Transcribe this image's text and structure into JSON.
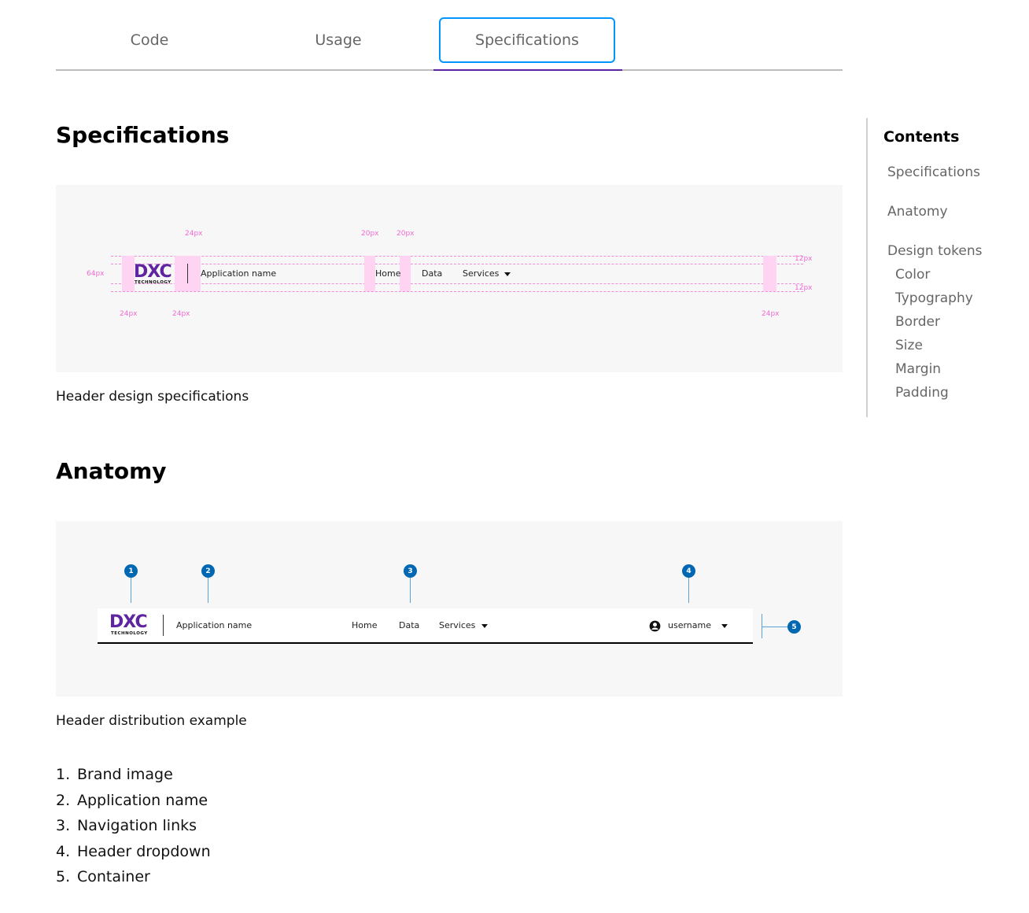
{
  "tabs": [
    {
      "label": "Code"
    },
    {
      "label": "Usage"
    },
    {
      "label": "Specifications"
    }
  ],
  "sections": {
    "specifications": {
      "title": "Specifications",
      "caption": "Header design specifications",
      "diagram": {
        "app_name": "Application name",
        "nav": [
          "Home",
          "Data",
          "Services"
        ],
        "logo_text": "DXC",
        "logo_sub": "TECHNOLOGY",
        "measure_24": "24px",
        "measure_20": "20px",
        "measure_64": "64px",
        "measure_12": "12px"
      }
    },
    "anatomy": {
      "title": "Anatomy",
      "caption": "Header distribution example",
      "diagram": {
        "app_name": "Application name",
        "nav": [
          "Home",
          "Data",
          "Services"
        ],
        "username": "username",
        "logo_text": "DXC",
        "logo_sub": "TECHNOLOGY",
        "badges": [
          "1",
          "2",
          "3",
          "4",
          "5"
        ]
      },
      "list": [
        {
          "num": "1.",
          "label": "Brand image"
        },
        {
          "num": "2.",
          "label": "Application name"
        },
        {
          "num": "3.",
          "label": "Navigation links"
        },
        {
          "num": "4.",
          "label": "Header dropdown"
        },
        {
          "num": "5.",
          "label": "Container"
        }
      ]
    }
  },
  "toc": {
    "title": "Contents",
    "items": [
      {
        "label": "Specifications"
      },
      {
        "label": "Anatomy"
      },
      {
        "label": "Design tokens"
      },
      {
        "label": "Color"
      },
      {
        "label": "Typography"
      },
      {
        "label": "Border"
      },
      {
        "label": "Size"
      },
      {
        "label": "Margin"
      },
      {
        "label": "Padding"
      }
    ]
  },
  "colors": {
    "accent": "#5f249f",
    "focus": "#0095ff",
    "badge": "#0067b3",
    "spec_pink": "#f06ad3"
  },
  "icons": {
    "dropdown": "caret-down-icon",
    "user": "user-circle-icon"
  }
}
